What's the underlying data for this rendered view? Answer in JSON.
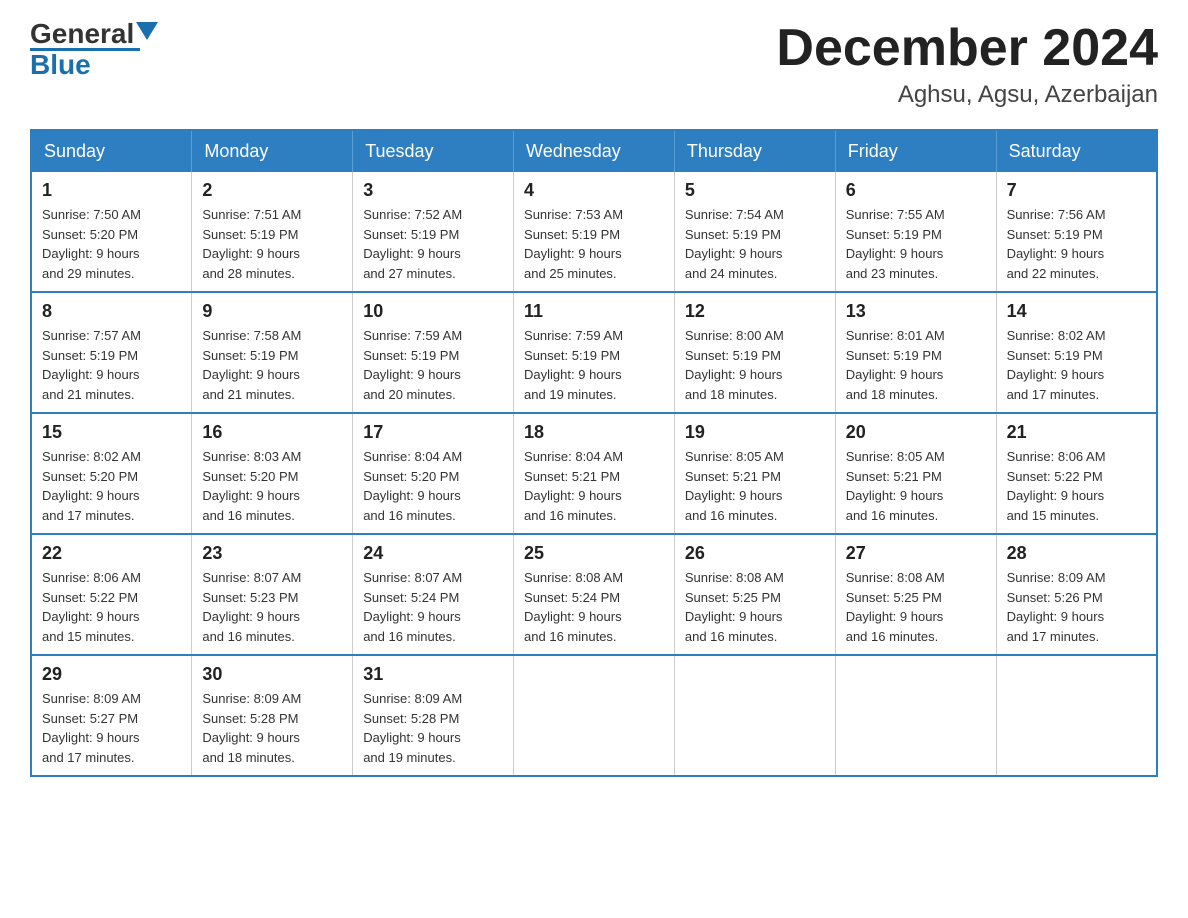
{
  "logo": {
    "general": "General",
    "blue": "Blue"
  },
  "header": {
    "month": "December 2024",
    "location": "Aghsu, Agsu, Azerbaijan"
  },
  "days_of_week": [
    "Sunday",
    "Monday",
    "Tuesday",
    "Wednesday",
    "Thursday",
    "Friday",
    "Saturday"
  ],
  "weeks": [
    [
      {
        "day": "1",
        "sunrise": "7:50 AM",
        "sunset": "5:20 PM",
        "daylight": "9 hours and 29 minutes."
      },
      {
        "day": "2",
        "sunrise": "7:51 AM",
        "sunset": "5:19 PM",
        "daylight": "9 hours and 28 minutes."
      },
      {
        "day": "3",
        "sunrise": "7:52 AM",
        "sunset": "5:19 PM",
        "daylight": "9 hours and 27 minutes."
      },
      {
        "day": "4",
        "sunrise": "7:53 AM",
        "sunset": "5:19 PM",
        "daylight": "9 hours and 25 minutes."
      },
      {
        "day": "5",
        "sunrise": "7:54 AM",
        "sunset": "5:19 PM",
        "daylight": "9 hours and 24 minutes."
      },
      {
        "day": "6",
        "sunrise": "7:55 AM",
        "sunset": "5:19 PM",
        "daylight": "9 hours and 23 minutes."
      },
      {
        "day": "7",
        "sunrise": "7:56 AM",
        "sunset": "5:19 PM",
        "daylight": "9 hours and 22 minutes."
      }
    ],
    [
      {
        "day": "8",
        "sunrise": "7:57 AM",
        "sunset": "5:19 PM",
        "daylight": "9 hours and 21 minutes."
      },
      {
        "day": "9",
        "sunrise": "7:58 AM",
        "sunset": "5:19 PM",
        "daylight": "9 hours and 21 minutes."
      },
      {
        "day": "10",
        "sunrise": "7:59 AM",
        "sunset": "5:19 PM",
        "daylight": "9 hours and 20 minutes."
      },
      {
        "day": "11",
        "sunrise": "7:59 AM",
        "sunset": "5:19 PM",
        "daylight": "9 hours and 19 minutes."
      },
      {
        "day": "12",
        "sunrise": "8:00 AM",
        "sunset": "5:19 PM",
        "daylight": "9 hours and 18 minutes."
      },
      {
        "day": "13",
        "sunrise": "8:01 AM",
        "sunset": "5:19 PM",
        "daylight": "9 hours and 18 minutes."
      },
      {
        "day": "14",
        "sunrise": "8:02 AM",
        "sunset": "5:19 PM",
        "daylight": "9 hours and 17 minutes."
      }
    ],
    [
      {
        "day": "15",
        "sunrise": "8:02 AM",
        "sunset": "5:20 PM",
        "daylight": "9 hours and 17 minutes."
      },
      {
        "day": "16",
        "sunrise": "8:03 AM",
        "sunset": "5:20 PM",
        "daylight": "9 hours and 16 minutes."
      },
      {
        "day": "17",
        "sunrise": "8:04 AM",
        "sunset": "5:20 PM",
        "daylight": "9 hours and 16 minutes."
      },
      {
        "day": "18",
        "sunrise": "8:04 AM",
        "sunset": "5:21 PM",
        "daylight": "9 hours and 16 minutes."
      },
      {
        "day": "19",
        "sunrise": "8:05 AM",
        "sunset": "5:21 PM",
        "daylight": "9 hours and 16 minutes."
      },
      {
        "day": "20",
        "sunrise": "8:05 AM",
        "sunset": "5:21 PM",
        "daylight": "9 hours and 16 minutes."
      },
      {
        "day": "21",
        "sunrise": "8:06 AM",
        "sunset": "5:22 PM",
        "daylight": "9 hours and 15 minutes."
      }
    ],
    [
      {
        "day": "22",
        "sunrise": "8:06 AM",
        "sunset": "5:22 PM",
        "daylight": "9 hours and 15 minutes."
      },
      {
        "day": "23",
        "sunrise": "8:07 AM",
        "sunset": "5:23 PM",
        "daylight": "9 hours and 16 minutes."
      },
      {
        "day": "24",
        "sunrise": "8:07 AM",
        "sunset": "5:24 PM",
        "daylight": "9 hours and 16 minutes."
      },
      {
        "day": "25",
        "sunrise": "8:08 AM",
        "sunset": "5:24 PM",
        "daylight": "9 hours and 16 minutes."
      },
      {
        "day": "26",
        "sunrise": "8:08 AM",
        "sunset": "5:25 PM",
        "daylight": "9 hours and 16 minutes."
      },
      {
        "day": "27",
        "sunrise": "8:08 AM",
        "sunset": "5:25 PM",
        "daylight": "9 hours and 16 minutes."
      },
      {
        "day": "28",
        "sunrise": "8:09 AM",
        "sunset": "5:26 PM",
        "daylight": "9 hours and 17 minutes."
      }
    ],
    [
      {
        "day": "29",
        "sunrise": "8:09 AM",
        "sunset": "5:27 PM",
        "daylight": "9 hours and 17 minutes."
      },
      {
        "day": "30",
        "sunrise": "8:09 AM",
        "sunset": "5:28 PM",
        "daylight": "9 hours and 18 minutes."
      },
      {
        "day": "31",
        "sunrise": "8:09 AM",
        "sunset": "5:28 PM",
        "daylight": "9 hours and 19 minutes."
      },
      null,
      null,
      null,
      null
    ]
  ],
  "labels": {
    "sunrise": "Sunrise:",
    "sunset": "Sunset:",
    "daylight": "Daylight:"
  }
}
